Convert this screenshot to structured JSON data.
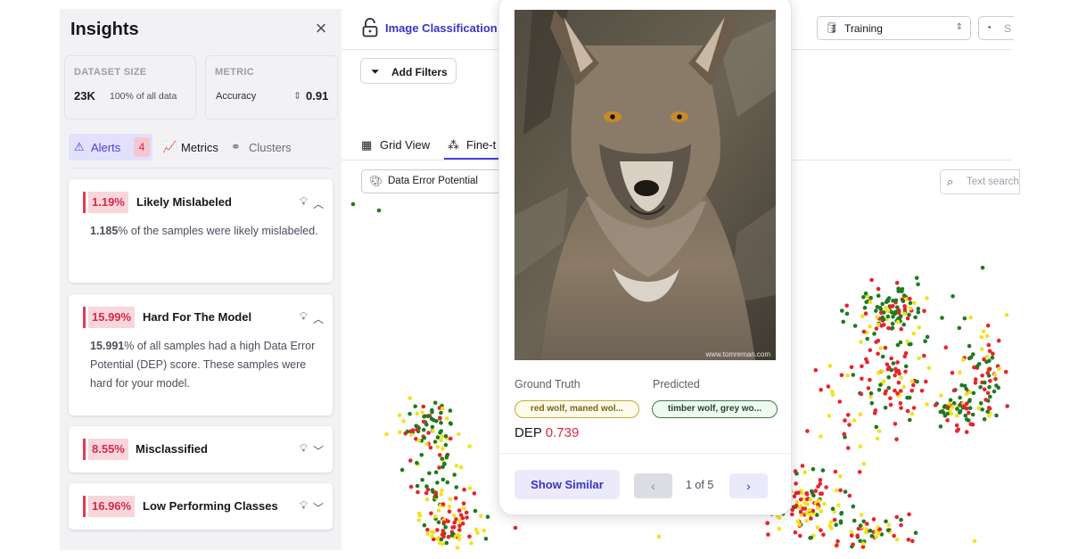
{
  "insights": {
    "title": "Insights",
    "dataset_size": {
      "label": "DATASET SIZE",
      "value": "23K",
      "sub": "100% of all data"
    },
    "metric": {
      "label": "METRIC",
      "name": "Accuracy",
      "value": "0.91"
    },
    "tabs": [
      {
        "label": "Alerts",
        "badge": "4",
        "icon": "alert-triangle-icon"
      },
      {
        "label": "Metrics",
        "icon": "line-chart-icon"
      },
      {
        "label": "Clusters",
        "icon": "clusters-icon"
      }
    ],
    "alerts": [
      {
        "pct": "1.19%",
        "name": "Likely Mislabeled",
        "body_bold": "1.185",
        "body_rest": "% of the samples were likely mislabeled.",
        "expanded": true
      },
      {
        "pct": "15.99%",
        "name": "Hard For The Model",
        "body_bold": "15.991",
        "body_rest": "% of all samples had a high Data Error Potential (DEP) score. These samples were hard for your model.",
        "expanded": true
      },
      {
        "pct": "8.55%",
        "name": "Misclassified",
        "expanded": false
      },
      {
        "pct": "16.96%",
        "name": "Low Performing Classes",
        "expanded": false
      }
    ]
  },
  "topbar": {
    "project_name": "Image Classification",
    "split": "Training",
    "cut_label": "S"
  },
  "toolbar": {
    "add_filters": "Add Filters"
  },
  "views": {
    "grid": "Grid View",
    "fine": "Fine-t"
  },
  "color_by": "Data Error Potential",
  "text_search_placeholder": "Text search",
  "sample": {
    "credit": "www.tomreman.com",
    "ground_truth_label": "Ground Truth",
    "predicted_label": "Predicted",
    "ground_truth": "red wolf, maned wol...",
    "predicted": "timber wolf, grey wo...",
    "dep_label": "DEP",
    "dep_value": "0.739",
    "show_similar": "Show Similar",
    "pager": "1 of 5"
  },
  "colors": {
    "accent": "#4a3fd6",
    "high_dep": "#e8232d",
    "mid_dep": "#f2e21c",
    "low_dep": "#1f7a1f"
  }
}
